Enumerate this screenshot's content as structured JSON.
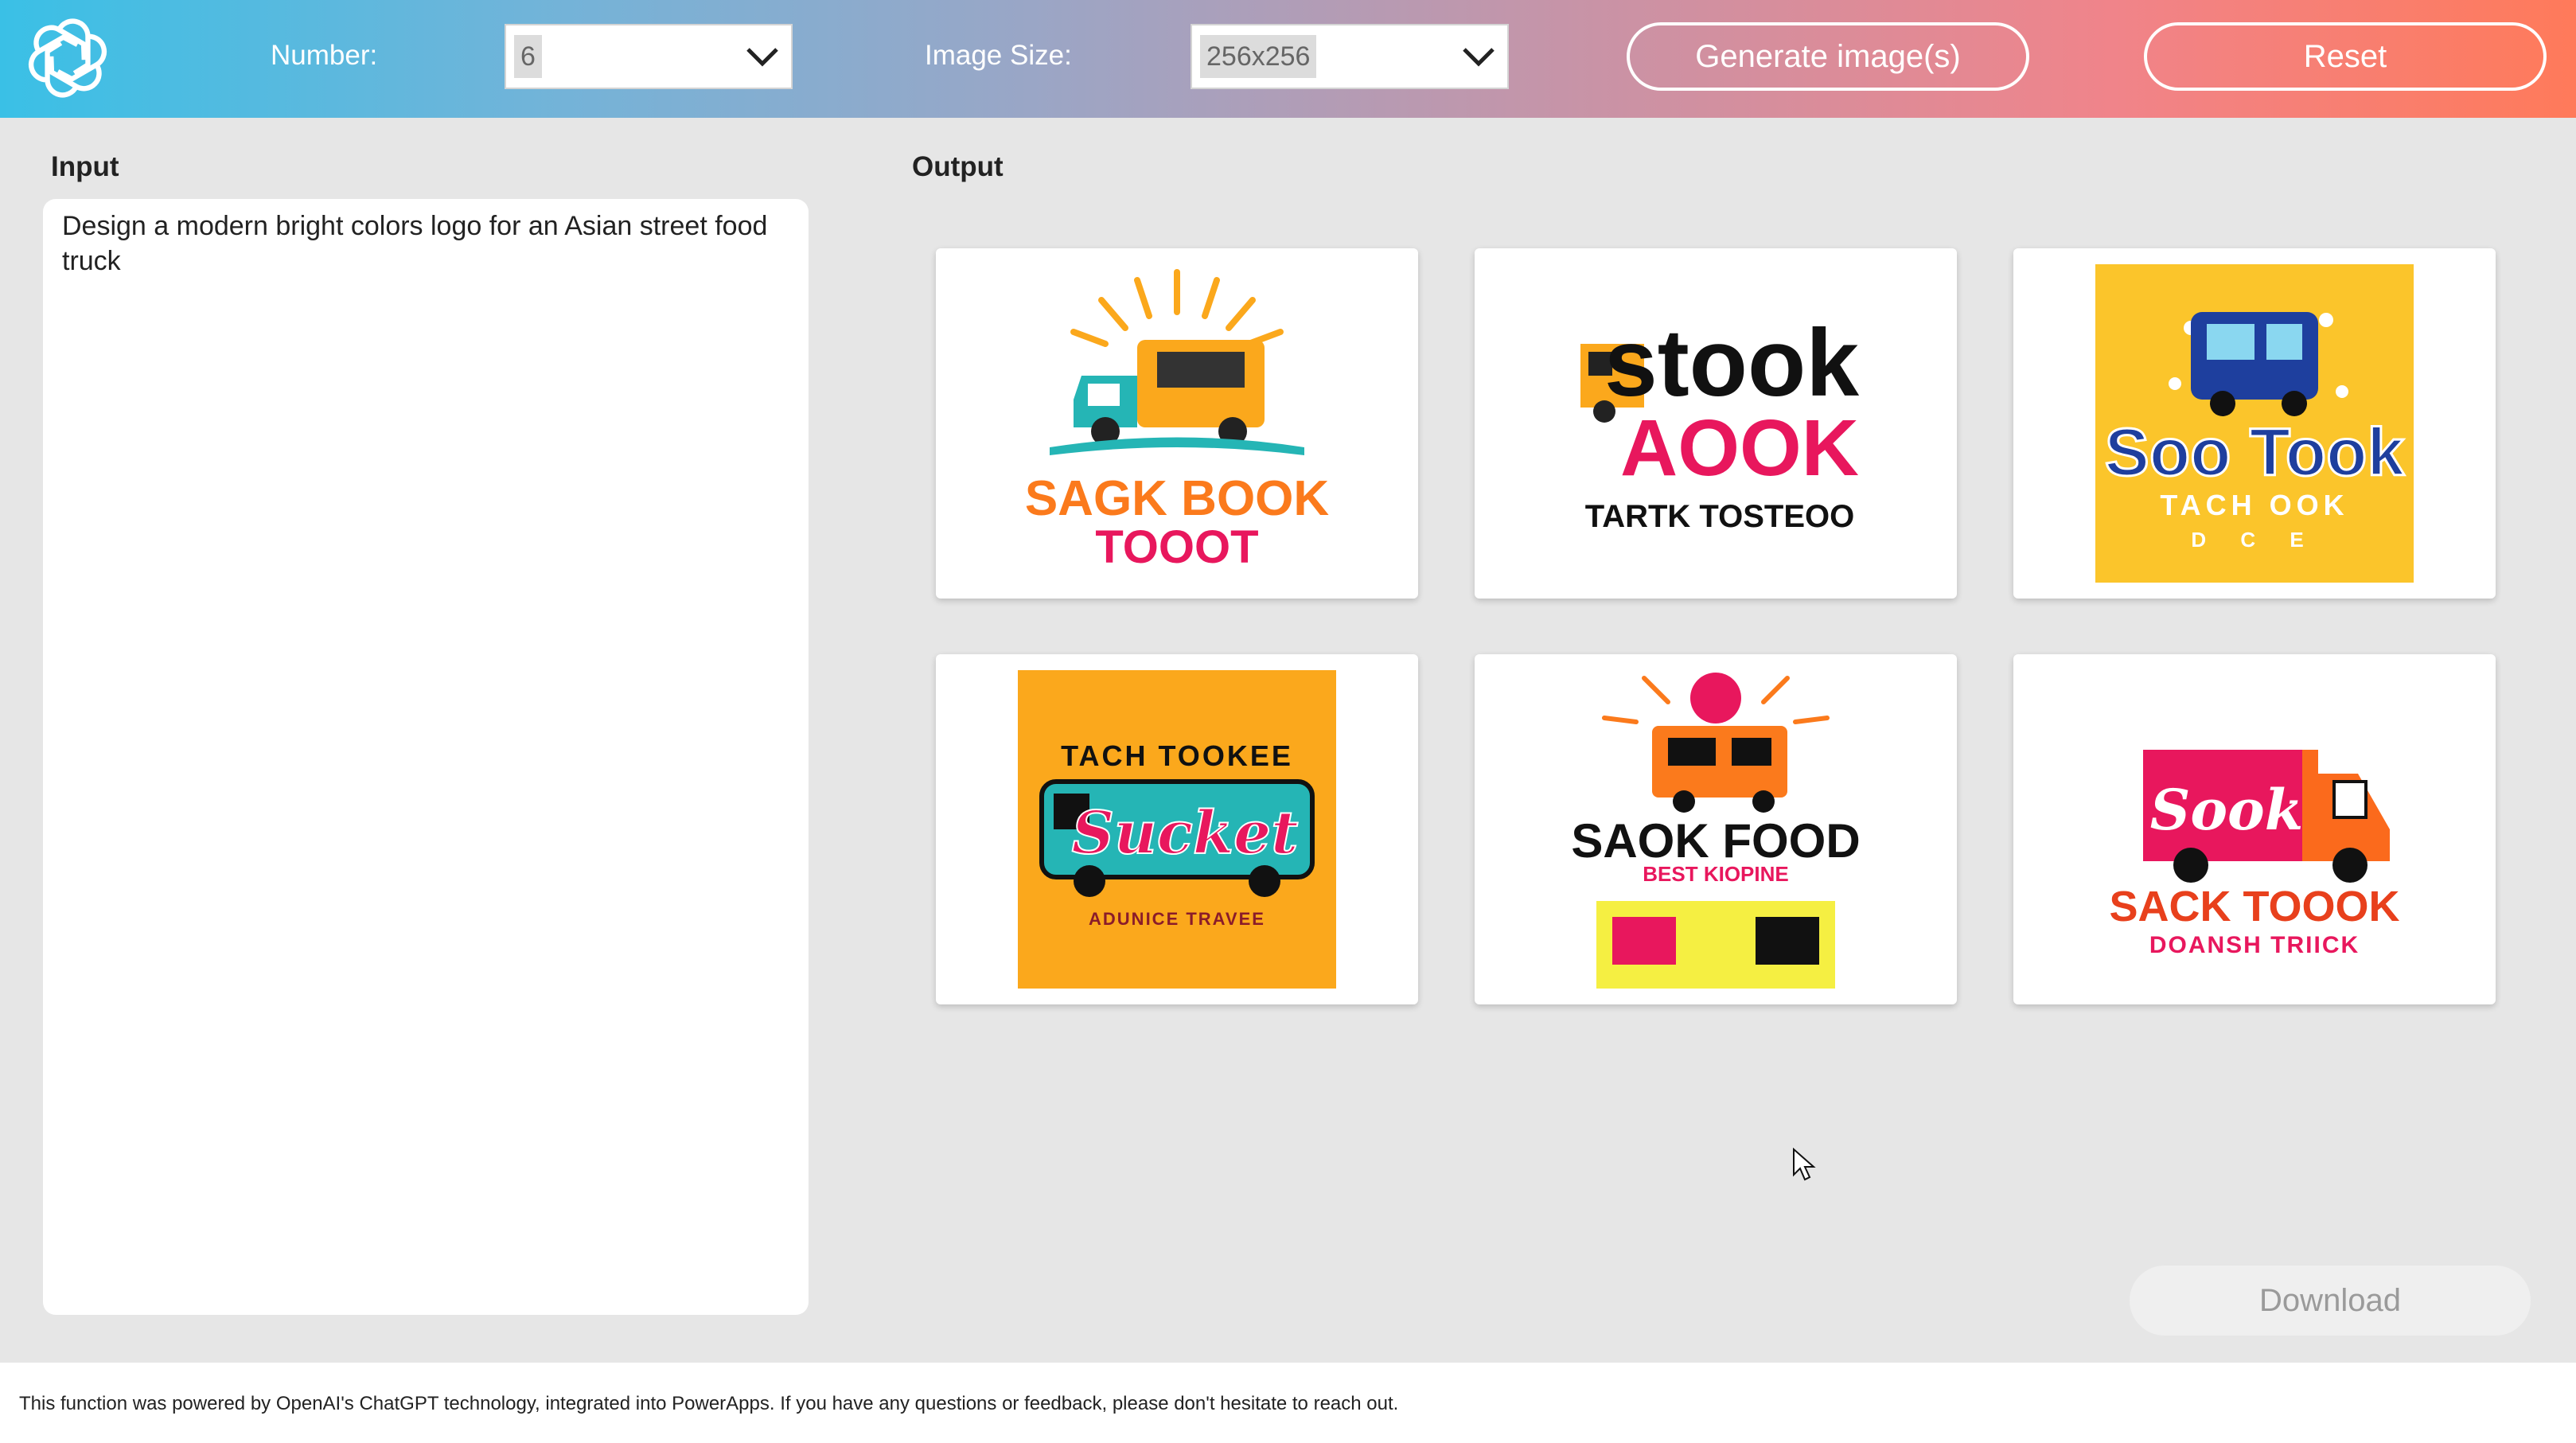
{
  "header": {
    "number_label": "Number:",
    "number_value": "6",
    "size_label": "Image Size:",
    "size_value": "256x256",
    "generate_label": "Generate image(s)",
    "reset_label": "Reset",
    "logo_icon": "openai-logo-icon"
  },
  "input": {
    "label": "Input",
    "prompt": "Design a modern bright colors logo for an Asian street food truck"
  },
  "output": {
    "label": "Output",
    "images": [
      {
        "line1": "SAGK BOOK",
        "line2": "TOOOT"
      },
      {
        "line1": "stook",
        "line2": "AOOK",
        "line3": "TARTK TOSTEOO"
      },
      {
        "line1": "Soo Took",
        "line2": "TACH OOK",
        "line3": "D C E"
      },
      {
        "line1": "TACH TOOKEE",
        "line2": "Sucket",
        "line3": "ADUNICE TRAVEE"
      },
      {
        "line1": "SAOK FOOD",
        "line2": "BEST KIOPINE"
      },
      {
        "line1": "Sook",
        "line2": "SACK TOOOK",
        "line3": "DOANSH TRIICK"
      }
    ],
    "download_label": "Download"
  },
  "footer": {
    "text": "This function was powered by OpenAI's ChatGPT technology, integrated into PowerApps. If you have any questions or feedback, please don't hesitate to reach out."
  },
  "colors": {
    "accent_yellow": "#fbc52b",
    "accent_orange": "#fba81c",
    "accent_pink": "#e8175d",
    "accent_teal": "#25b5b5"
  }
}
